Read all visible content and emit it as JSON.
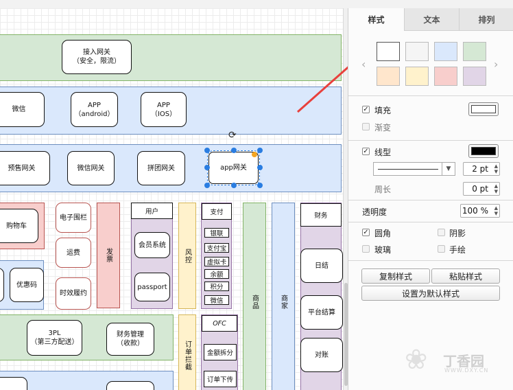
{
  "canvas": {
    "row1": {
      "gateway": "接入网关\n（安全，限流）"
    },
    "row2": {
      "wechat": "微信",
      "app_android": "APP\n（android）",
      "app_ios": "APP\n（IOS）"
    },
    "row3": {
      "presale_gw": "预售网关",
      "wechat_gw": "微信网关",
      "group_gw": "拼团网关",
      "app_gw": "app网关"
    },
    "modules": {
      "cart": "购物车",
      "e_fence": "电子围栏",
      "freight": "运费",
      "perf": "时效履约",
      "invoice": "发票",
      "coupon": "优惠码",
      "user_title": "用户",
      "member": "会员系统",
      "passport": "passport",
      "risk": "风控",
      "pay_title": "支付",
      "pay_items": [
        "银联",
        "支付宝",
        "虚拟卡",
        "余额",
        "积分",
        "微信"
      ],
      "goods": "商品",
      "merchant": "商家",
      "finance_title": "财务",
      "daily": "日结",
      "platform_settle": "平台结算",
      "reconcile": "对账",
      "tpl": "3PL\n（第三方配送）",
      "fin_mgmt": "财务管理\n（收款）",
      "order_intercept": "订单拦截",
      "ofc": "OFC",
      "amount_split": "金额拆分",
      "order_push": "订单下传"
    }
  },
  "panel": {
    "tabs": [
      "样式",
      "文本",
      "排列"
    ],
    "swatches": [
      "#ffffff",
      "#f5f5f5",
      "#dae8fc",
      "#d5e8d4",
      "#ffe6cc",
      "#fff2cc",
      "#f8cecc",
      "#e1d5e7"
    ],
    "fill": {
      "label": "填充",
      "checked": true,
      "color": "#ffffff"
    },
    "gradient": {
      "label": "渐变",
      "checked": false
    },
    "line": {
      "label": "线型",
      "checked": true,
      "color": "#000000",
      "width": "2 pt"
    },
    "perimeter": {
      "label": "周长",
      "value": "0 pt"
    },
    "opacity": {
      "label": "透明度",
      "value": "100 %"
    },
    "options": [
      {
        "label": "圆角",
        "checked": true
      },
      {
        "label": "阴影",
        "checked": false
      },
      {
        "label": "玻璃",
        "checked": false
      },
      {
        "label": "手绘",
        "checked": false
      }
    ],
    "buttons": {
      "copy_style": "复制样式",
      "paste_style": "粘贴样式",
      "set_default": "设置为默认样式"
    },
    "watermark": "丁香园",
    "watermark_url": "WWW.DXY.CN"
  },
  "colors": {
    "accent_arrow": "#e8403c",
    "selection": "#2a7de1"
  }
}
